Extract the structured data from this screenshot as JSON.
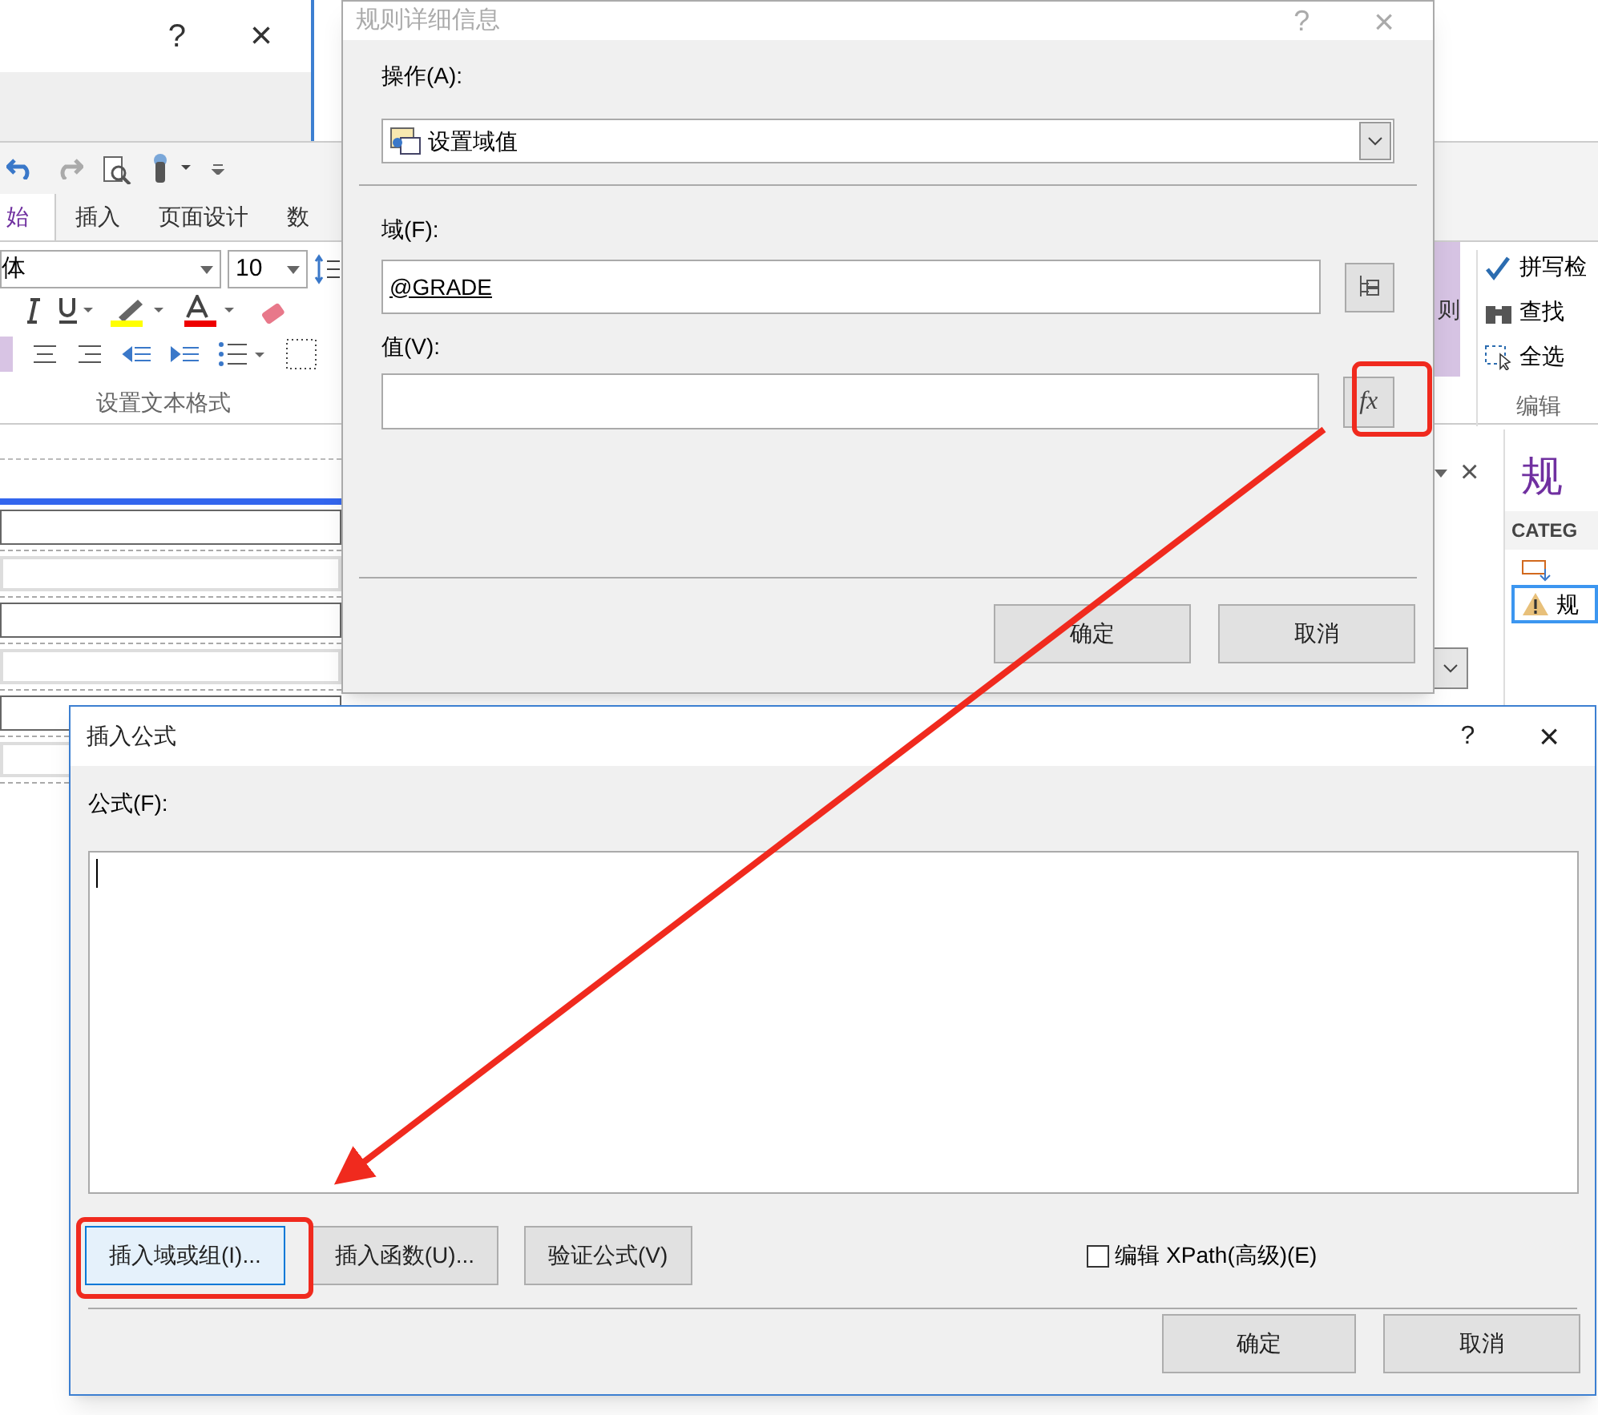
{
  "background_app": {
    "top_window": {
      "help": "?",
      "close": "×"
    },
    "ribbon_tabs": [
      {
        "label": "始",
        "selected": true
      },
      {
        "label": "插入",
        "selected": false
      },
      {
        "label": "页面设计",
        "selected": false
      },
      {
        "label": "数",
        "selected": false
      }
    ],
    "font_name": "体",
    "font_size": "10",
    "format_group_label": "设置文本格式",
    "side_button": "则",
    "editing_items": [
      {
        "label": "拼写检",
        "kind": "spell"
      },
      {
        "label": "查找",
        "kind": "find"
      },
      {
        "label": "全选",
        "kind": "select"
      }
    ],
    "editing_group_label": "编辑",
    "pane": {
      "close": "×",
      "title": "规",
      "category": "CATEG",
      "item": "规"
    }
  },
  "rule_dialog": {
    "title": "规则详细信息",
    "help": "?",
    "close": "×",
    "action_label": "操作(A):",
    "action_value": "设置域值",
    "field_label": "域(F):",
    "field_value": "@GRADE",
    "value_label": "值(V):",
    "fx": "fx",
    "ok": "确定",
    "cancel": "取消"
  },
  "formula_dialog": {
    "title": "插入公式",
    "help": "?",
    "close": "×",
    "formula_label": "公式(F):",
    "buttons": [
      {
        "label": "插入域或组(I)...",
        "selected": true
      },
      {
        "label": "插入函数(U)...",
        "selected": false
      },
      {
        "label": "验证公式(V)",
        "selected": false
      }
    ],
    "xpath": {
      "label": "编辑 XPath(高级)(E)",
      "checked": false
    },
    "ok": "确定",
    "cancel": "取消"
  }
}
